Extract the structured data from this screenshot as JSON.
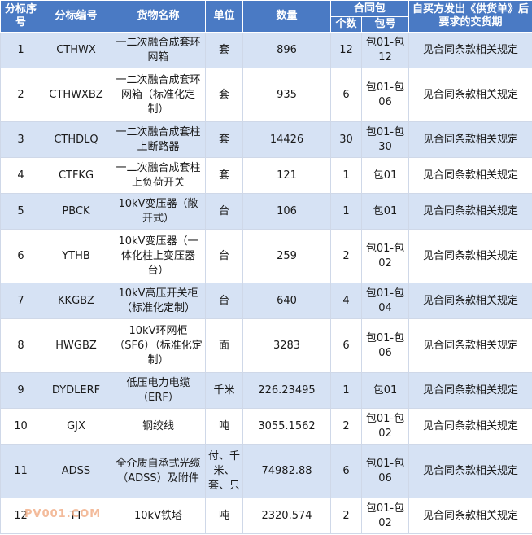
{
  "headers": {
    "seq": "分标序号",
    "code": "分标编号",
    "name": "货物名称",
    "unit": "单位",
    "qty": "数量",
    "contract": "合同包",
    "count": "个数",
    "pkg": "包号",
    "delivery": "自买方发出《供货单》后要求的交货期"
  },
  "rows": [
    {
      "seq": "1",
      "code": "CTHWX",
      "name": "一二次融合成套环网箱",
      "unit": "套",
      "qty": "896",
      "count": "12",
      "pkg": "包01-包12",
      "delivery": "见合同条款相关规定"
    },
    {
      "seq": "2",
      "code": "CTHWXBZ",
      "name": "一二次融合成套环网箱（标准化定制）",
      "unit": "套",
      "qty": "935",
      "count": "6",
      "pkg": "包01-包06",
      "delivery": "见合同条款相关规定"
    },
    {
      "seq": "3",
      "code": "CTHDLQ",
      "name": "一二次融合成套柱上断路器",
      "unit": "套",
      "qty": "14426",
      "count": "30",
      "pkg": "包01-包30",
      "delivery": "见合同条款相关规定"
    },
    {
      "seq": "4",
      "code": "CTFKG",
      "name": "一二次融合成套柱上负荷开关",
      "unit": "套",
      "qty": "121",
      "count": "1",
      "pkg": "包01",
      "delivery": "见合同条款相关规定"
    },
    {
      "seq": "5",
      "code": "PBCK",
      "name": "10kV变压器（敞开式）",
      "unit": "台",
      "qty": "106",
      "count": "1",
      "pkg": "包01",
      "delivery": "见合同条款相关规定"
    },
    {
      "seq": "6",
      "code": "YTHB",
      "name": "10kV变压器（一体化柱上变压器台）",
      "unit": "台",
      "qty": "259",
      "count": "2",
      "pkg": "包01-包02",
      "delivery": "见合同条款相关规定"
    },
    {
      "seq": "7",
      "code": "KKGBZ",
      "name": "10kV高压开关柜（标准化定制）",
      "unit": "台",
      "qty": "640",
      "count": "4",
      "pkg": "包01-包04",
      "delivery": "见合同条款相关规定"
    },
    {
      "seq": "8",
      "code": "HWGBZ",
      "name": "10kV环网柜（SF6）（标准化定制）",
      "unit": "面",
      "qty": "3283",
      "count": "6",
      "pkg": "包01-包06",
      "delivery": "见合同条款相关规定"
    },
    {
      "seq": "9",
      "code": "DYDLERF",
      "name": "低压电力电缆（ERF）",
      "unit": "千米",
      "qty": "226.23495",
      "count": "1",
      "pkg": "包01",
      "delivery": "见合同条款相关规定"
    },
    {
      "seq": "10",
      "code": "GJX",
      "name": "钢绞线",
      "unit": "吨",
      "qty": "3055.1562",
      "count": "2",
      "pkg": "包01-包02",
      "delivery": "见合同条款相关规定"
    },
    {
      "seq": "11",
      "code": "ADSS",
      "name": "全介质自承式光缆（ADSS）及附件",
      "unit": "付、千米、套、只",
      "qty": "74982.88",
      "count": "6",
      "pkg": "包01-包06",
      "delivery": "见合同条款相关规定"
    },
    {
      "seq": "12",
      "code": "TT",
      "name": "10kV铁塔",
      "unit": "吨",
      "qty": "2320.574",
      "count": "2",
      "pkg": "包01-包02",
      "delivery": "见合同条款相关规定"
    }
  ],
  "watermark": "PV001.COM"
}
